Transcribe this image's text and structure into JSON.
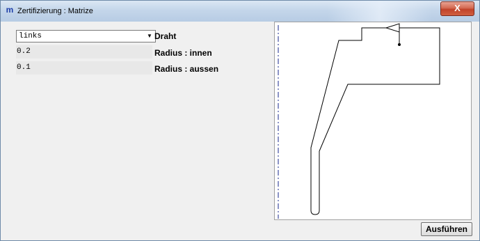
{
  "window": {
    "app_icon": "m",
    "title": "Zertifizierung : Matrize",
    "close_label": "X"
  },
  "form": {
    "draht": {
      "value": "links",
      "label": "Draht"
    },
    "radius_innen": {
      "value": "0.2",
      "label": "Radius : innen"
    },
    "radius_aussen": {
      "value": "0.1",
      "label": "Radius : aussen"
    }
  },
  "preview": {
    "icons": [
      "centerline",
      "die-profile-outline",
      "arrow-marker"
    ]
  },
  "actions": {
    "run_label": "Ausführen"
  }
}
